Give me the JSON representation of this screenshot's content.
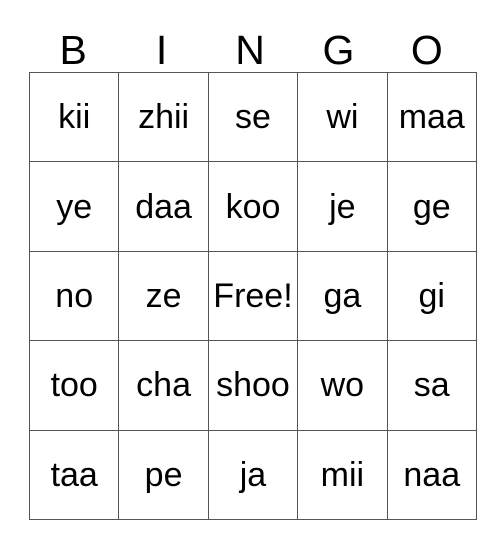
{
  "card": {
    "header_letters": [
      "B",
      "I",
      "N",
      "G",
      "O"
    ],
    "rows": [
      {
        "cells": [
          "kii",
          "zhii",
          "se",
          "wi",
          "maa"
        ]
      },
      {
        "cells": [
          "ye",
          "daa",
          "koo",
          "je",
          "ge"
        ]
      },
      {
        "cells": [
          "no",
          "ze",
          "Free!",
          "ga",
          "gi"
        ]
      },
      {
        "cells": [
          "too",
          "cha",
          "shoo",
          "wo",
          "sa"
        ]
      },
      {
        "cells": [
          "taa",
          "pe",
          "ja",
          "mii",
          "naa"
        ]
      }
    ],
    "colors": {
      "background": "#ffffff",
      "text": "#000000",
      "grid_line": "#555555"
    }
  }
}
